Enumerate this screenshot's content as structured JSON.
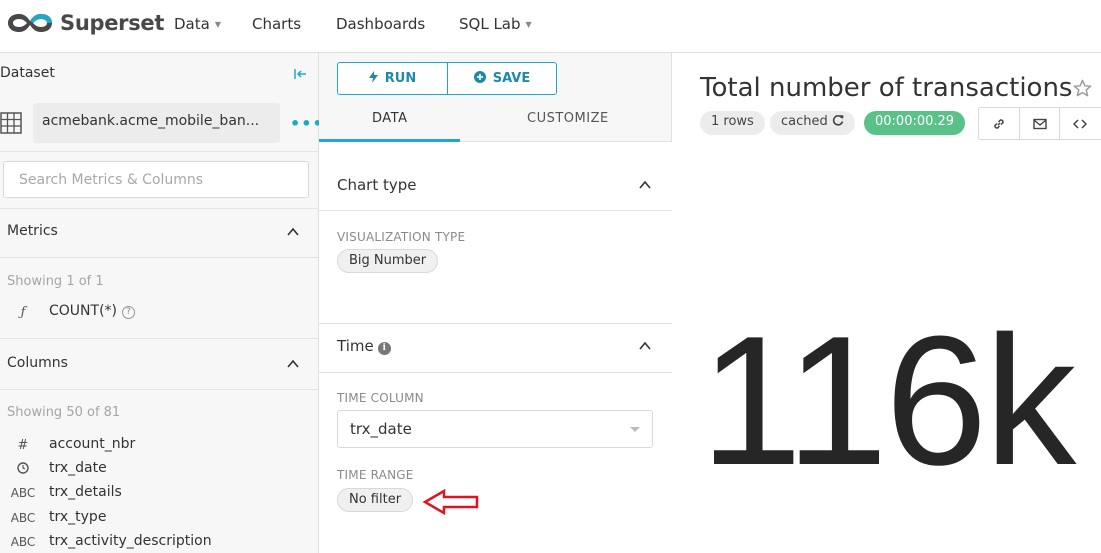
{
  "navbar": {
    "brand": "Superset",
    "items": [
      {
        "label": "Data",
        "has_caret": true
      },
      {
        "label": "Charts",
        "has_caret": false
      },
      {
        "label": "Dashboards",
        "has_caret": false
      },
      {
        "label": "SQL Lab",
        "has_caret": true
      }
    ]
  },
  "dataset_panel": {
    "header": "Dataset",
    "dataset_name": "acmebank.acme_mobile_ban...",
    "search_placeholder": "Search Metrics & Columns",
    "metrics": {
      "title": "Metrics",
      "showing": "Showing 1 of 1",
      "items": [
        {
          "type": "ƒ",
          "name": "COUNT(*)"
        }
      ]
    },
    "columns": {
      "title": "Columns",
      "showing": "Showing 50 of 81",
      "items": [
        {
          "type": "#",
          "name": "account_nbr"
        },
        {
          "type": "clock",
          "name": "trx_date"
        },
        {
          "type": "ABC",
          "name": "trx_details"
        },
        {
          "type": "ABC",
          "name": "trx_type"
        },
        {
          "type": "ABC",
          "name": "trx_activity_description"
        }
      ]
    }
  },
  "controls_panel": {
    "run_label": "RUN",
    "save_label": "SAVE",
    "tabs": [
      "DATA",
      "CUSTOMIZE"
    ],
    "chart_type_section": "Chart type",
    "viz_type_label": "VISUALIZATION TYPE",
    "viz_type_value": "Big Number",
    "time_section": "Time",
    "time_column_label": "TIME COLUMN",
    "time_column_value": "trx_date",
    "time_range_label": "TIME RANGE",
    "time_range_value": "No filter"
  },
  "chart": {
    "title": "Total number of transactions",
    "rows_badge": "1 rows",
    "cached_badge": "cached",
    "duration_badge": "00:00:00.29",
    "big_number": "116k"
  },
  "colors": {
    "accent": "#20a7c9",
    "success": "#5ac189",
    "annotation_arrow": "#e0141e"
  }
}
